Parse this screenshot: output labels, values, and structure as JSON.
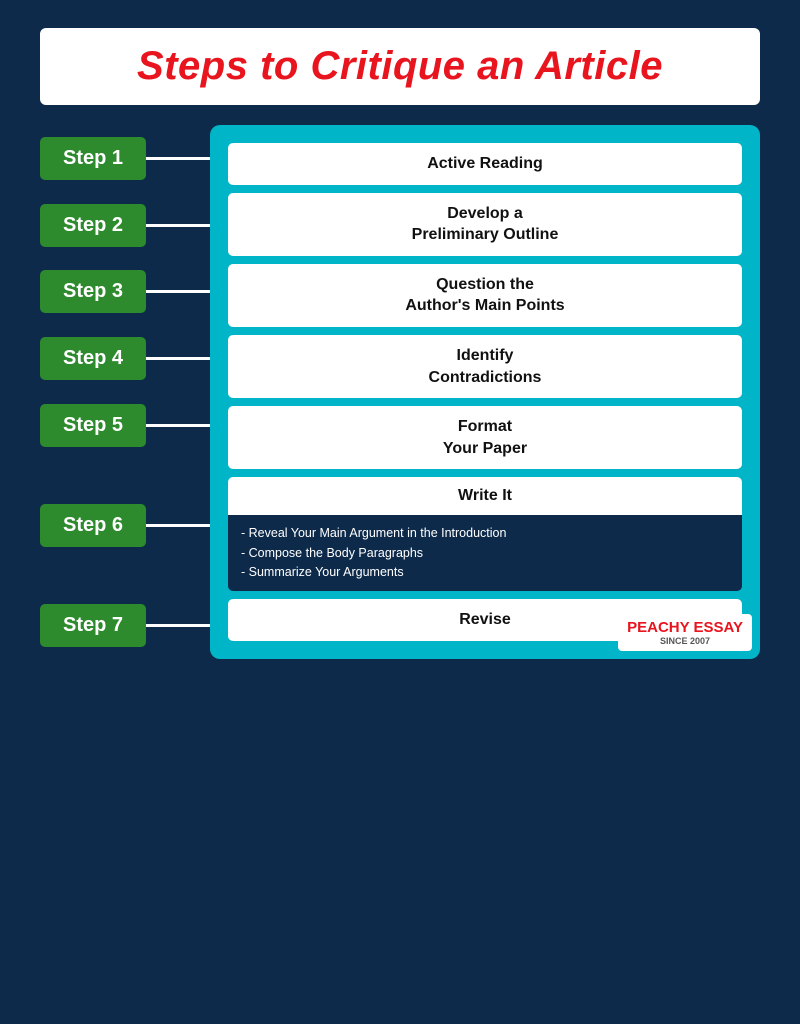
{
  "title": "Steps to Critique an Article",
  "steps": [
    {
      "label": "Step 1",
      "id": "step-1"
    },
    {
      "label": "Step 2",
      "id": "step-2"
    },
    {
      "label": "Step 3",
      "id": "step-3"
    },
    {
      "label": "Step 4",
      "id": "step-4"
    },
    {
      "label": "Step 5",
      "id": "step-5"
    },
    {
      "label": "Step 6",
      "id": "step-6"
    },
    {
      "label": "Step 7",
      "id": "step-7"
    }
  ],
  "content": [
    {
      "id": "c1",
      "text": "Active Reading",
      "type": "white"
    },
    {
      "id": "c2",
      "text": "Develop a\nPreliminary Outline",
      "type": "white"
    },
    {
      "id": "c3",
      "text": "Question the\nAuthor's Main Points",
      "type": "white"
    },
    {
      "id": "c4",
      "text": "Identify\nContradictions",
      "type": "white"
    },
    {
      "id": "c5",
      "text": "Format\nYour Paper",
      "type": "white"
    },
    {
      "id": "c6-top",
      "text": "Write It",
      "type": "write-white"
    },
    {
      "id": "c6-sub",
      "lines": [
        "- Reveal Your Main Argument in the Introduction",
        "- Compose the Body Paragraphs",
        "- Summarize Your Arguments"
      ],
      "type": "write-dark"
    },
    {
      "id": "c7",
      "text": "Revise",
      "type": "white"
    }
  ],
  "logo": {
    "brand": "PEACHY ESSAY",
    "since": "SINCE 2007"
  }
}
